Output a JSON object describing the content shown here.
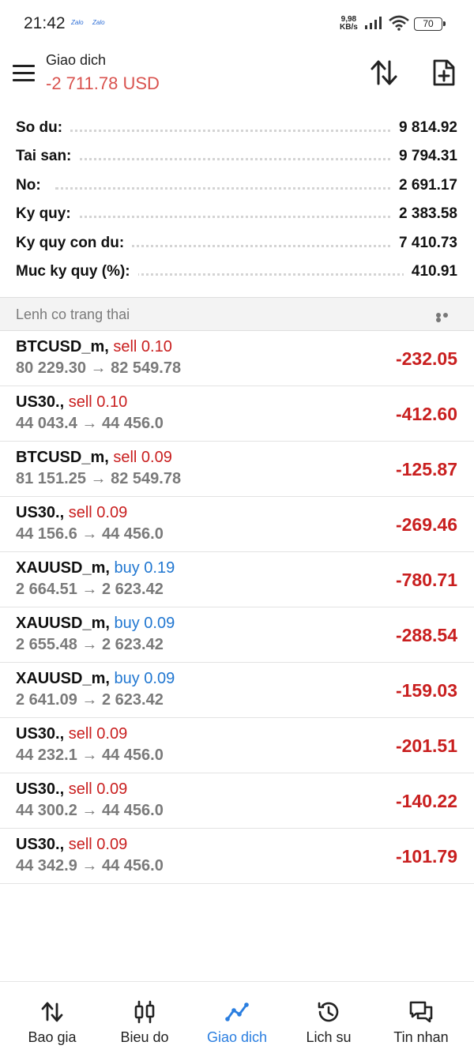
{
  "status_bar": {
    "time": "21:42",
    "app_icons": [
      "Zalo",
      "Zalo"
    ],
    "net_speed_value": "9,98",
    "net_speed_unit": "KB/s",
    "battery": "70"
  },
  "header": {
    "title": "Giao dich",
    "floating_pl": "-2 711.78 USD",
    "pl_color": "#d9534f"
  },
  "summary": [
    {
      "label": "So du:",
      "value": "9 814.92"
    },
    {
      "label": "Tai san:",
      "value": "9 794.31"
    },
    {
      "label": "No:",
      "value": "2 691.17"
    },
    {
      "label": "Ky quy:",
      "value": "2 383.58"
    },
    {
      "label": "Ky quy con du:",
      "value": "7 410.73"
    },
    {
      "label": "Muc ky quy (%):",
      "value": "410.91"
    }
  ],
  "section": {
    "title": "Lenh co trang thai"
  },
  "positions": [
    {
      "symbol": "BTCUSD_m,",
      "side": "sell 0.10",
      "prices": "80 229.30 → 82 549.78",
      "profit": "-232.05"
    },
    {
      "symbol": "US30.,",
      "side": "sell 0.10",
      "prices": "44 043.4 → 44 456.0",
      "profit": "-412.60"
    },
    {
      "symbol": "BTCUSD_m,",
      "side": "sell 0.09",
      "prices": "81 151.25 → 82 549.78",
      "profit": "-125.87"
    },
    {
      "symbol": "US30.,",
      "side": "sell 0.09",
      "prices": "44 156.6 → 44 456.0",
      "profit": "-269.46"
    },
    {
      "symbol": "XAUUSD_m,",
      "side": "buy 0.19",
      "prices": "2 664.51 → 2 623.42",
      "profit": "-780.71"
    },
    {
      "symbol": "XAUUSD_m,",
      "side": "buy 0.09",
      "prices": "2 655.48 → 2 623.42",
      "profit": "-288.54"
    },
    {
      "symbol": "XAUUSD_m,",
      "side": "buy 0.09",
      "prices": "2 641.09 → 2 623.42",
      "profit": "-159.03"
    },
    {
      "symbol": "US30.,",
      "side": "sell 0.09",
      "prices": "44 232.1 → 44 456.0",
      "profit": "-201.51"
    },
    {
      "symbol": "US30.,",
      "side": "sell 0.09",
      "prices": "44 300.2 → 44 456.0",
      "profit": "-140.22"
    },
    {
      "symbol": "US30.,",
      "side": "sell 0.09",
      "prices": "44 342.9 → 44 456.0",
      "profit": "-101.79"
    }
  ],
  "colors": {
    "sell": "#c91f1f",
    "buy": "#2177d1",
    "loss": "#c91f1f",
    "active_tab": "#2a7ee0"
  },
  "bottom_nav": [
    {
      "label": "Bao gia",
      "icon": "quotes-arrows-icon",
      "active": false
    },
    {
      "label": "Bieu do",
      "icon": "candlestick-chart-icon",
      "active": false
    },
    {
      "label": "Giao dich",
      "icon": "trade-line-icon",
      "active": true
    },
    {
      "label": "Lich su",
      "icon": "history-clock-icon",
      "active": false
    },
    {
      "label": "Tin nhan",
      "icon": "messages-icon",
      "active": false
    }
  ]
}
